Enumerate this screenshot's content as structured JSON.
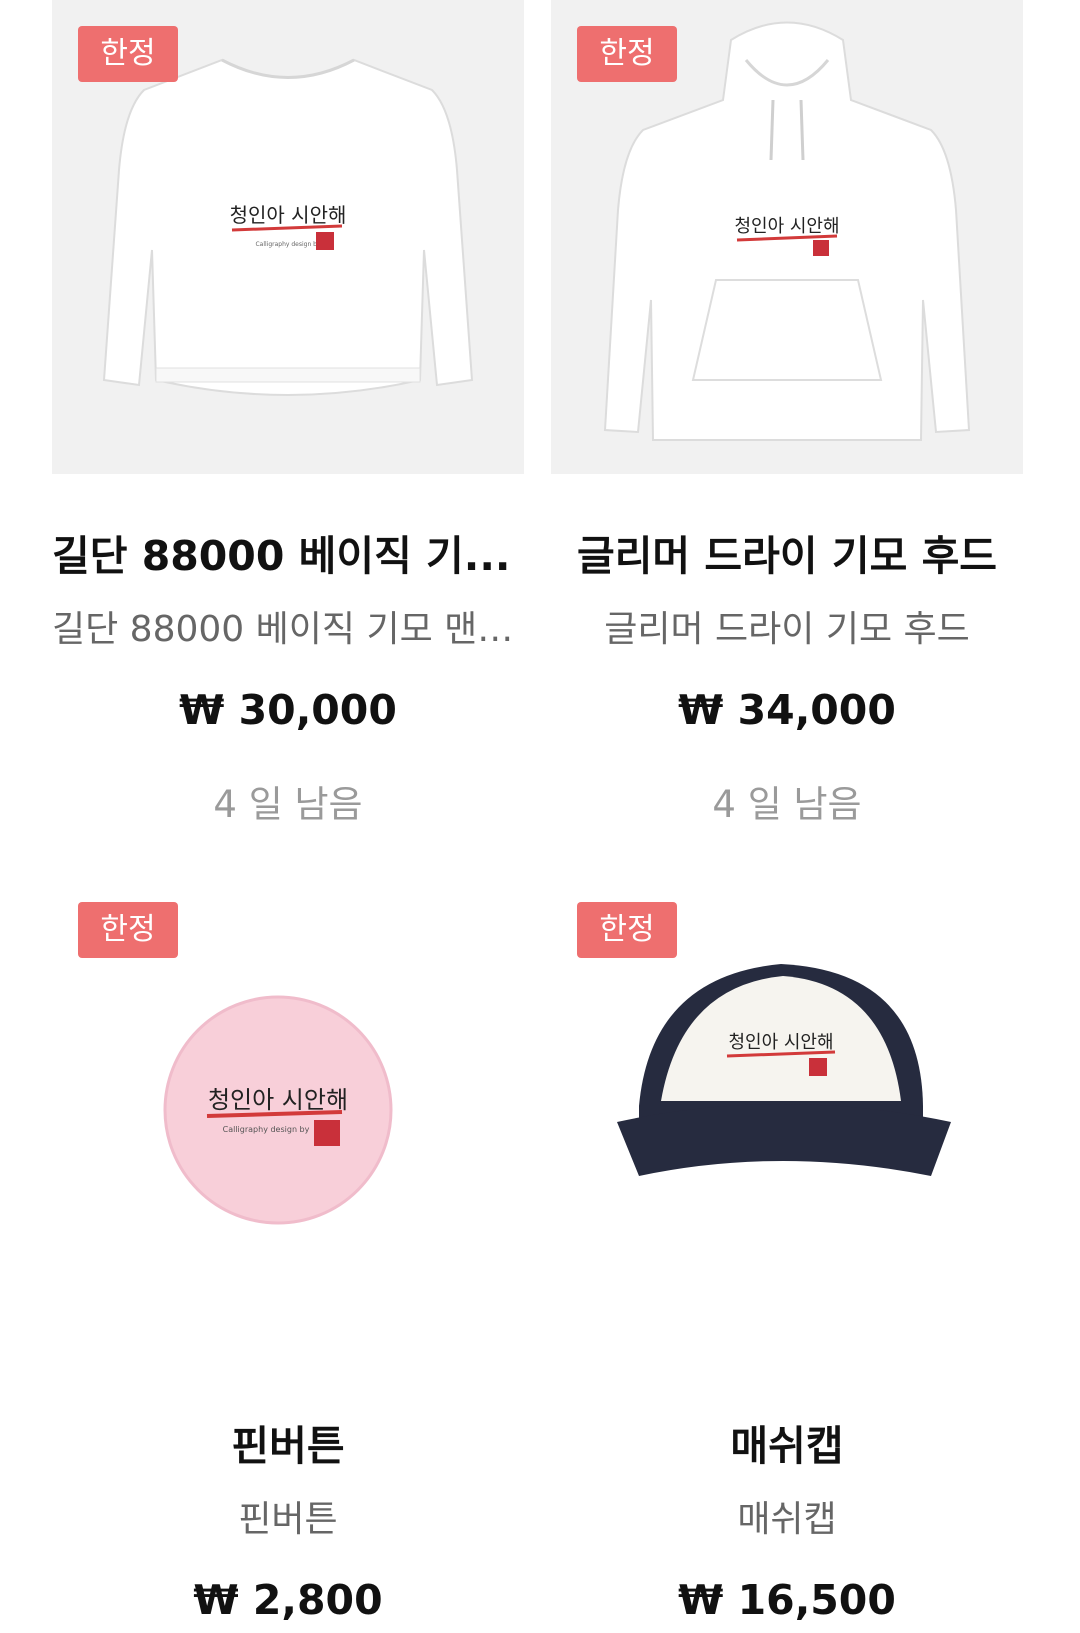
{
  "products": [
    {
      "badge": "한정",
      "title": "길단 88000 베이직 기...",
      "subtitle": "길단 88000 베이직 기모 맨투...",
      "price": "₩ 30,000",
      "remaining": "4 일 남음",
      "image_icon": "sweatshirt-icon"
    },
    {
      "badge": "한정",
      "title": "글리머 드라이 기모 후드",
      "subtitle": "글리머 드라이 기모 후드",
      "price": "₩ 34,000",
      "remaining": "4 일 남음",
      "image_icon": "hoodie-icon"
    },
    {
      "badge": "한정",
      "title": "핀버튼",
      "subtitle": "핀버튼",
      "price": "₩ 2,800",
      "image_icon": "pin-button-icon"
    },
    {
      "badge": "한정",
      "title": "매쉬캡",
      "subtitle": "매쉬캡",
      "price": "₩ 16,500",
      "image_icon": "mesh-cap-icon"
    }
  ],
  "logo": {
    "text": "청인아 시안해",
    "caption": "Calligraphy design by"
  },
  "colors": {
    "badge": "#ee6f6f",
    "thumb_bg": "#f1f1f1",
    "pin_pink": "#f8cfd9",
    "cap_navy": "#262b3f"
  }
}
